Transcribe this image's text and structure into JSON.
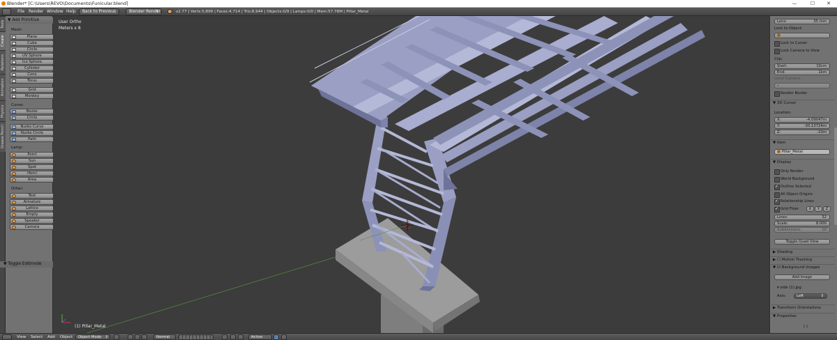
{
  "window": {
    "title": "Blender* [C:\\Users\\REVO\\Documents\\Funicular.blend]",
    "controls": [
      "—",
      "☐",
      "✕"
    ]
  },
  "info_header": {
    "menus": [
      "File",
      "Render",
      "Window",
      "Help"
    ],
    "back_button": "Back to Previous",
    "engine": "Blender Render",
    "stats": "v2.77 | Verts:5,899 | Faces:4,714 | Tris:8,944 | Objects:0/9 | Lamps:0/0 | Mem:57.76M | Pillar_Metal"
  },
  "tool_tabs": [
    "Tools",
    "Create",
    "Relations",
    "Animation",
    "Physics",
    "Grease Pencil"
  ],
  "tool_shelf": {
    "panel_title": "Add Primitive",
    "groups": [
      {
        "label": "Mesh:",
        "items": [
          "Plane",
          "Cube",
          "Circle",
          "UV Sphere",
          "Ico Sphere",
          "Cylinder",
          "Cone",
          "Torus",
          "Grid",
          "Monkey"
        ]
      },
      {
        "label": "Curve:",
        "items": [
          "Bezier",
          "Circle",
          "Nurbs Curve",
          "Nurbs Circle",
          "Path"
        ]
      },
      {
        "label": "Lamp:",
        "items": [
          "Point",
          "Sun",
          "Spot",
          "Hemi",
          "Area"
        ]
      },
      {
        "label": "Other:",
        "items": [
          "Text",
          "Armature",
          "Lattice",
          "Empty",
          "Speaker",
          "Camera"
        ]
      }
    ],
    "toggle_editmode": "Toggle Editmode"
  },
  "viewport": {
    "view_name": "User Ortho",
    "units": "Meters x 8",
    "active_object_label": "(1) Pillar_Metal"
  },
  "properties": {
    "lens": {
      "label": "Lens:",
      "value": "35 mm"
    },
    "lock_to_object_label": "Lock to Object:",
    "lock_to_cursor": "Lock to Cursor",
    "lock_camera_to_view": "Lock Camera to View",
    "clip_label": "Clip:",
    "clip_start": {
      "label": "Start:",
      "value": "10cm"
    },
    "clip_end": {
      "label": "End:",
      "value": "1km"
    },
    "local_camera_label": "Local Camera:",
    "render_border": "Render Border",
    "cursor_section": "3D Cursor",
    "location_label": "Location:",
    "cursor_x": {
      "label": "X:",
      "value": "-4.09047m"
    },
    "cursor_y": {
      "label": "Y:",
      "value": "-30.13724m"
    },
    "cursor_z": {
      "label": "Z:",
      "value": "-10m"
    },
    "item_section": "Item",
    "item_name": "Pillar_Metal",
    "display_section": "Display",
    "only_render": "Only Render",
    "world_background": "World Background",
    "outline_selected": "Outline Selected",
    "all_object_origins": "All Object Origins",
    "relationship_lines": "Relationship Lines",
    "grid_floor": "Grid Floor",
    "axes": [
      "X",
      "Y",
      "Z"
    ],
    "lines": {
      "label": "Lines:",
      "value": "32"
    },
    "scale": {
      "label": "Scale:",
      "value": "8.000"
    },
    "subdivisions": {
      "label": "Subdivisions:",
      "value": "10"
    },
    "toggle_quad_view": "Toggle Quad View",
    "shading_section": "Shading",
    "motion_tracking_section": "Motion Tracking",
    "background_images_section": "Background Images",
    "add_image": "Add Image",
    "image_name": "side (1).jpg",
    "axis_label": "Axis:",
    "axis_value": "Left",
    "transform_orientations_section": "Transform Orientations",
    "properties_section": "Properties",
    "footer_hint": "( )"
  },
  "view3d_header": {
    "menus": [
      "View",
      "Select",
      "Add",
      "Object"
    ],
    "mode": "Object Mode",
    "shading": "Normal",
    "pivot": "Active"
  },
  "colors": {
    "steel": "#9a9fc3",
    "steel_dark": "#6f739a",
    "steel_light": "#b5b9d8",
    "concrete": "#9c9c9c",
    "concrete_dark": "#7e7e7e"
  }
}
